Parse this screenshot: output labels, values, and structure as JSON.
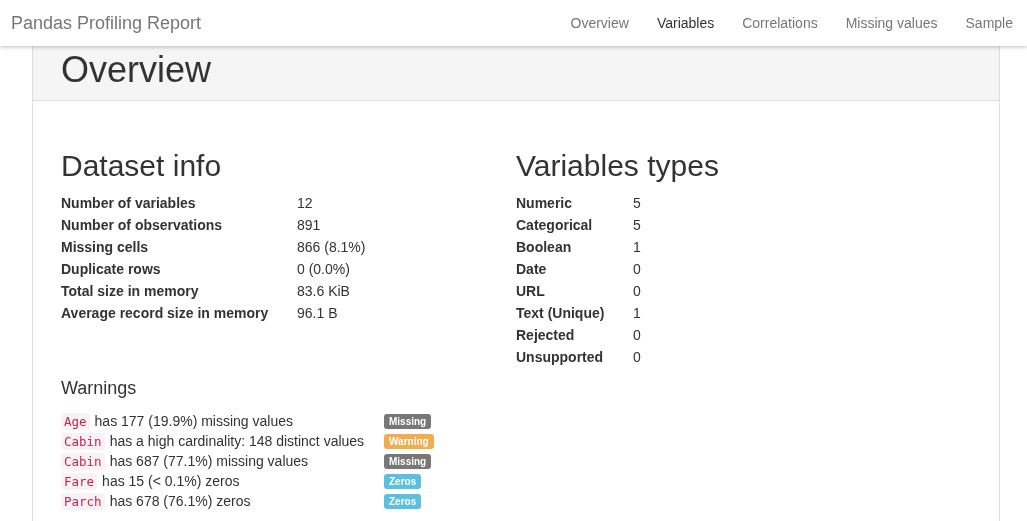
{
  "navbar": {
    "brand": "Pandas Profiling Report",
    "links": [
      "Overview",
      "Variables",
      "Correlations",
      "Missing values",
      "Sample"
    ]
  },
  "section_title": "Overview",
  "dataset_info": {
    "title": "Dataset info",
    "rows": [
      {
        "label": "Number of variables",
        "value": "12"
      },
      {
        "label": "Number of observations",
        "value": "891"
      },
      {
        "label": "Missing cells",
        "value": "866 (8.1%)"
      },
      {
        "label": "Duplicate rows",
        "value": "0 (0.0%)"
      },
      {
        "label": "Total size in memory",
        "value": "83.6 KiB"
      },
      {
        "label": "Average record size in memory",
        "value": "96.1 B"
      }
    ]
  },
  "variable_types": {
    "title": "Variables types",
    "rows": [
      {
        "label": "Numeric",
        "value": "5"
      },
      {
        "label": "Categorical",
        "value": "5"
      },
      {
        "label": "Boolean",
        "value": "1"
      },
      {
        "label": "Date",
        "value": "0"
      },
      {
        "label": "URL",
        "value": "0"
      },
      {
        "label": "Text (Unique)",
        "value": "1"
      },
      {
        "label": "Rejected",
        "value": "0"
      },
      {
        "label": "Unsupported",
        "value": "0"
      }
    ]
  },
  "warnings": {
    "title": "Warnings",
    "items": [
      {
        "variable": "Age",
        "message": "has 177 (19.9%) missing values",
        "badge": "Missing",
        "kind": "missing"
      },
      {
        "variable": "Cabin",
        "message": "has a high cardinality: 148 distinct values",
        "badge": "Warning",
        "kind": "warning"
      },
      {
        "variable": "Cabin",
        "message": "has 687 (77.1%) missing values",
        "badge": "Missing",
        "kind": "missing"
      },
      {
        "variable": "Fare",
        "message": "has 15 (< 0.1%) zeros",
        "badge": "Zeros",
        "kind": "zeros"
      },
      {
        "variable": "Parch",
        "message": "has 678 (76.1%) zeros",
        "badge": "Zeros",
        "kind": "zeros"
      }
    ]
  }
}
